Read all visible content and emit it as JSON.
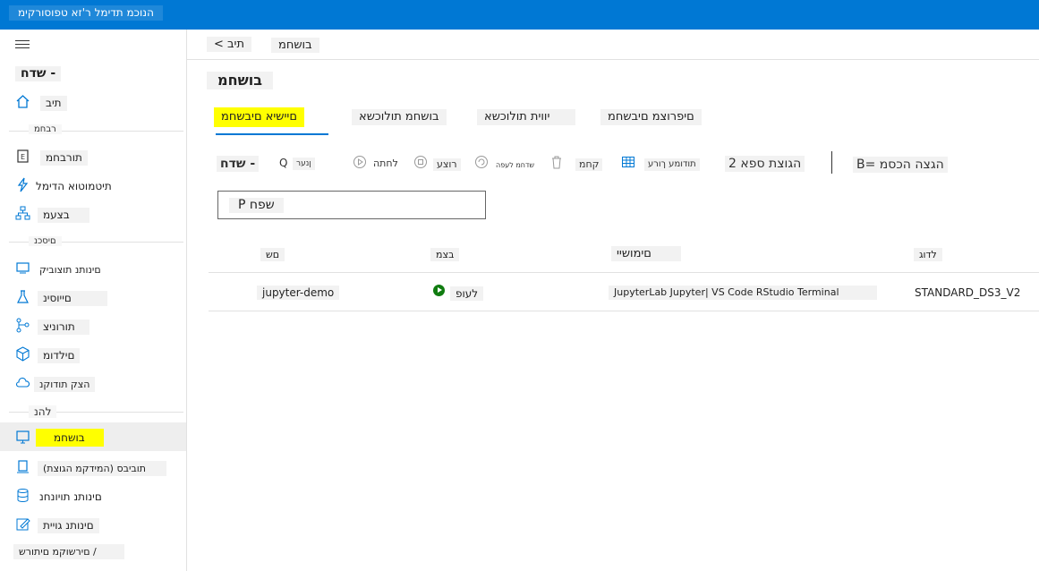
{
  "app": {
    "title": "הנוכמ תדימל ר'זא טפוסורקימ"
  },
  "sidebar": {
    "collapse_label": "שדח -",
    "home_label": "תיב",
    "section_author": "רבחמ",
    "notebooks_label": "תורבחמ",
    "automl_label": "תיטמוטוא הדימל",
    "designer_label": "בצעמ",
    "section_assets": "םיסכנ",
    "datasets_label": "םינותנ תוצוביק",
    "experiments_label": "םייוסינ",
    "pipelines_label": "תורוניצ",
    "models_label": "םילדומ",
    "endpoints_label": "הצק תודוקנ",
    "section_manage": "להנ",
    "compute_label": "בושחמ",
    "attached_compute_label": "(המידקמ הגוצת) תוביבס",
    "datastores_label": "םינותנ תויונחנ",
    "labeling_label": "םינותנ גויית",
    "linked_services_label": "םירשוקמ םיתורש /"
  },
  "breadcrumb": {
    "home": "< תיב",
    "current": "בושחמ"
  },
  "page": {
    "title": "בושחמ"
  },
  "tabs": [
    "םיישיא םיבשחמ",
    "בושחמ תולוכשא",
    "יווית תולוכשא",
    "םיפרוצמ םיבשחמ"
  ],
  "toolbar": {
    "new": "שדח -",
    "refresh": "ןנער",
    "start": "לחתה",
    "stop": "רוצע",
    "restart": "שדחמ לעפה",
    "delete": "קחמ",
    "edit_columns": "תודומע ךורע",
    "view_all": "2 הגוצת ספא",
    "filter": "B= הגצה הכסמ",
    "view_icon": "Q"
  },
  "search": {
    "placeholder": "P שפח"
  },
  "table": {
    "headers": [
      "םש",
      "בצמ",
      "םימושיי",
      "לדוג"
    ],
    "rows": [
      {
        "name": "jupyter-demo",
        "status": "לעופ",
        "apps": "JupyterLab Jupyter| VS Code RStudio Terminal",
        "size": "STANDARD_DS3_V2"
      }
    ]
  },
  "colors": {
    "accent": "#0078d4",
    "highlight": "#ffff00",
    "running": "#107c10"
  }
}
